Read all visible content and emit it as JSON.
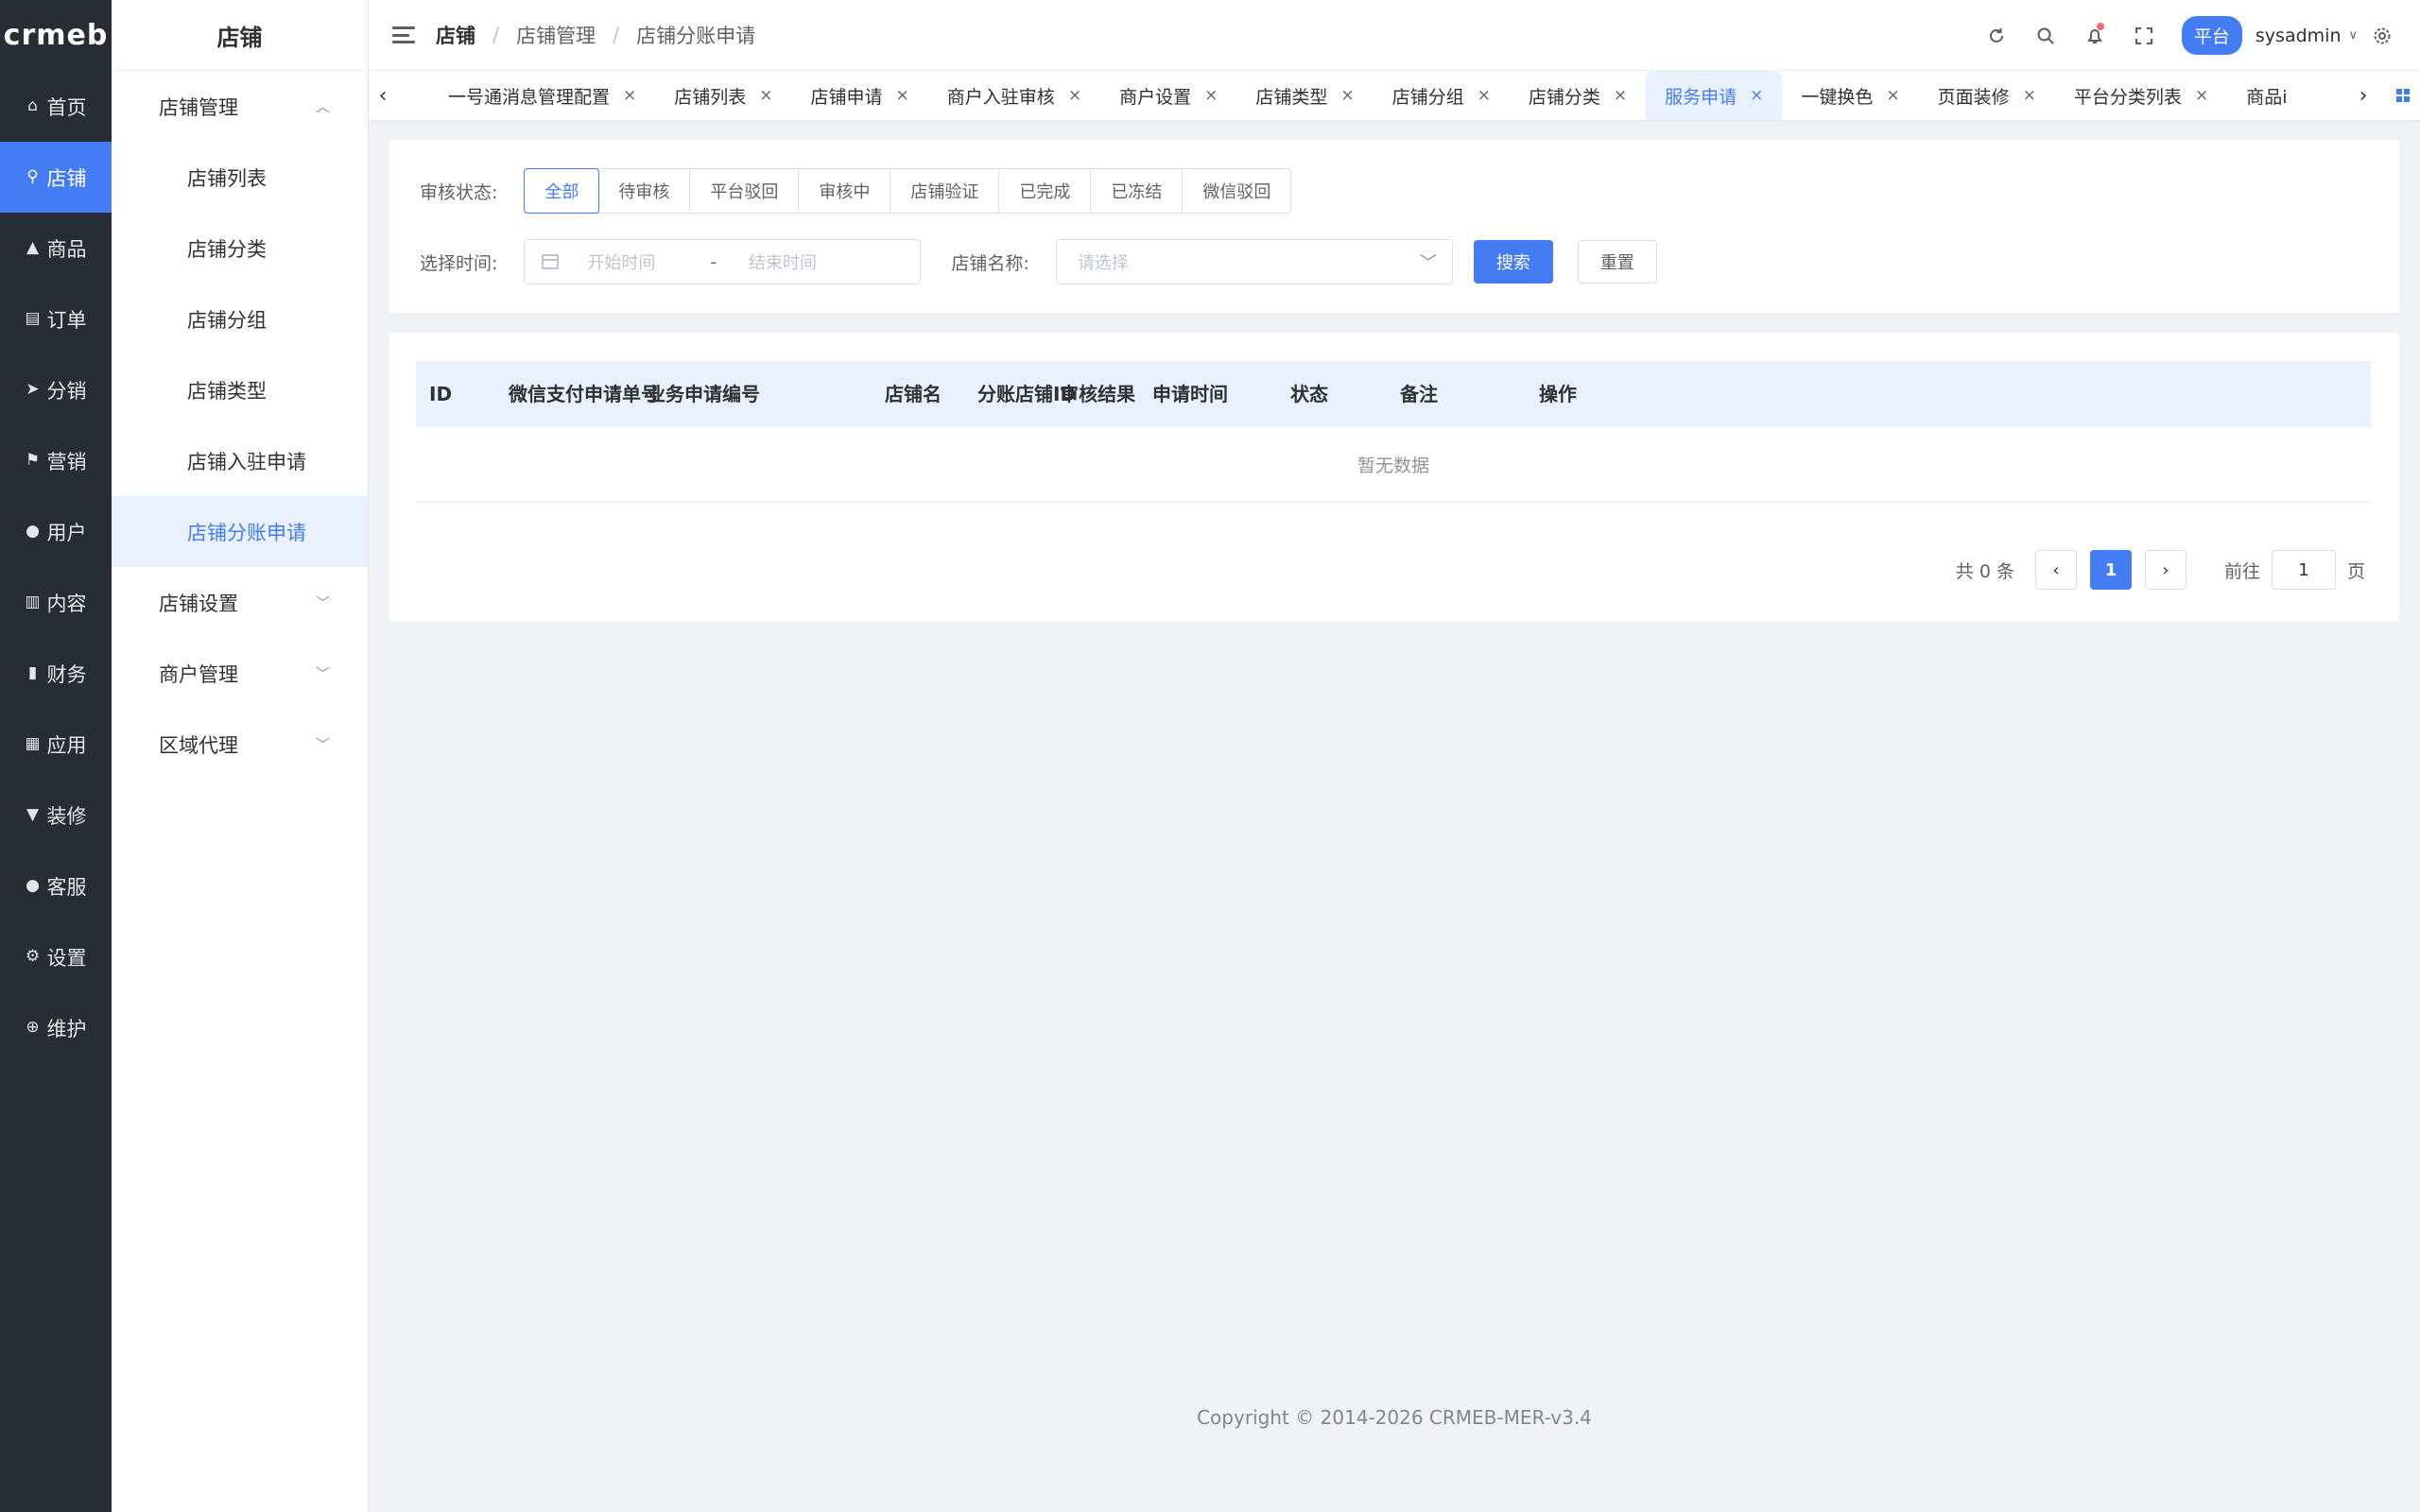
{
  "rail": {
    "logo": "crmeb",
    "items": [
      {
        "label": "首页",
        "icon": "home-icon",
        "glyph": "⌂"
      },
      {
        "label": "店铺",
        "icon": "store-icon",
        "glyph": "⚲",
        "active": true
      },
      {
        "label": "商品",
        "icon": "product-icon",
        "glyph": "▲"
      },
      {
        "label": "订单",
        "icon": "order-icon",
        "glyph": "▤"
      },
      {
        "label": "分销",
        "icon": "distribution-icon",
        "glyph": "➤"
      },
      {
        "label": "营销",
        "icon": "marketing-flag-icon",
        "glyph": "⚑"
      },
      {
        "label": "用户",
        "icon": "user-icon",
        "glyph": "●"
      },
      {
        "label": "内容",
        "icon": "content-icon",
        "glyph": "▥"
      },
      {
        "label": "财务",
        "icon": "finance-chart-icon",
        "glyph": "▮"
      },
      {
        "label": "应用",
        "icon": "apps-grid-icon",
        "glyph": "▦"
      },
      {
        "label": "装修",
        "icon": "decoration-icon",
        "glyph": "▼"
      },
      {
        "label": "客服",
        "icon": "customer-service-icon",
        "glyph": "●"
      },
      {
        "label": "设置",
        "icon": "settings-gear-icon",
        "glyph": "⚙"
      },
      {
        "label": "维护",
        "icon": "maintenance-icon",
        "glyph": "⊕"
      }
    ]
  },
  "subnav": {
    "title": "店铺",
    "group_store_manage": "店铺管理",
    "items": [
      "店铺列表",
      "店铺分类",
      "店铺分组",
      "店铺类型",
      "店铺入驻申请",
      "店铺分账申请"
    ],
    "group_store_settings": "店铺设置",
    "group_merchant_manage": "商户管理",
    "group_region_agent": "区域代理"
  },
  "breadcrumb": {
    "level1": "店铺",
    "level2": "店铺管理",
    "level3": "店铺分账申请",
    "separator": "/"
  },
  "header": {
    "platform_badge": "平台",
    "username": "sysadmin"
  },
  "tags": [
    {
      "label": "一号通消息管理配置"
    },
    {
      "label": "店铺列表"
    },
    {
      "label": "店铺申请"
    },
    {
      "label": "商户入驻审核"
    },
    {
      "label": "商户设置"
    },
    {
      "label": "店铺类型"
    },
    {
      "label": "店铺分组"
    },
    {
      "label": "店铺分类"
    },
    {
      "label": "服务申请",
      "active": true
    },
    {
      "label": "一键换色"
    },
    {
      "label": "页面装修"
    },
    {
      "label": "平台分类列表"
    },
    {
      "label": "商品i"
    }
  ],
  "filter": {
    "status_label": "审核状态:",
    "status_options": [
      "全部",
      "待审核",
      "平台驳回",
      "审核中",
      "店铺验证",
      "已完成",
      "已冻结",
      "微信驳回"
    ],
    "status_selected": "全部",
    "time_label": "选择时间:",
    "start_placeholder": "开始时间",
    "range_separator": "-",
    "end_placeholder": "结束时间",
    "store_label": "店铺名称:",
    "store_placeholder": "请选择",
    "search_button": "搜索",
    "reset_button": "重置"
  },
  "table": {
    "columns": [
      "ID",
      "微信支付申请单号",
      "业务申请编号",
      "店铺名",
      "分账店铺ID",
      "审核结果",
      "申请时间",
      "状态",
      "备注",
      "操作"
    ],
    "rows": [],
    "empty_text": "暂无数据"
  },
  "pagination": {
    "total_text": "共 0 条",
    "current_page": "1",
    "goto_label": "前往",
    "goto_value": "1",
    "page_suffix": "页"
  },
  "footer": {
    "copyright": "Copyright © 2014-2026 CRMEB-MER-v3.4"
  },
  "colors": {
    "accent": "#437cf3",
    "rail_bg": "#282c34",
    "page_bg": "#f0f2f5"
  }
}
